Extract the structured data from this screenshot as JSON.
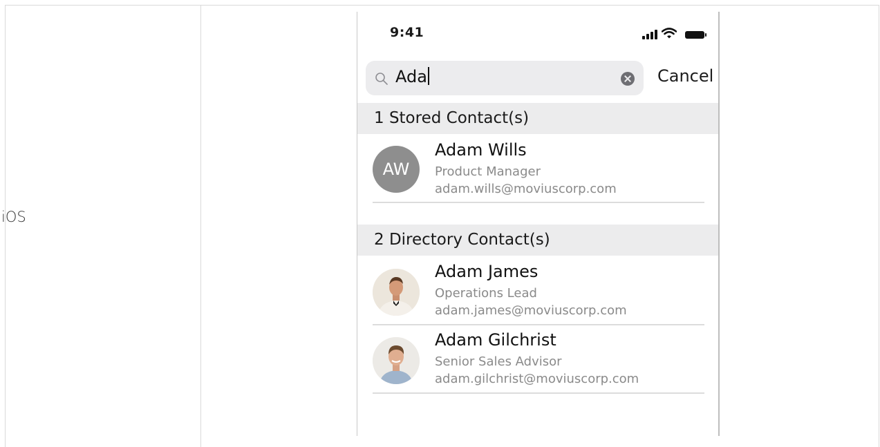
{
  "table": {
    "platform_label": "iOS"
  },
  "status_bar": {
    "time": "9:41",
    "icons": [
      "cellular-signal-icon",
      "wifi-icon",
      "battery-icon"
    ]
  },
  "search": {
    "query": "Ada",
    "cancel_label": "Cancel"
  },
  "stored_section": {
    "title": "1 Stored Contact(s)",
    "contacts": [
      {
        "name": "Adam Wills",
        "role": "Product Manager",
        "email": "adam.wills@moviuscorp.com",
        "initials": "AW"
      }
    ]
  },
  "directory_section": {
    "title": "2 Directory Contact(s)",
    "contacts": [
      {
        "name": "Adam James",
        "role": "Operations Lead",
        "email": "adam.james@moviuscorp.com"
      },
      {
        "name": "Adam Gilchrist",
        "role": "Senior Sales Advisor",
        "email": "adam.gilchrist@moviuscorp.com"
      }
    ]
  },
  "colors": {
    "section_header_bg": "#ececed",
    "search_bar_bg": "#ececee",
    "initials_avatar_bg": "#8e8e8e",
    "secondary_text": "#8a8a8a"
  }
}
